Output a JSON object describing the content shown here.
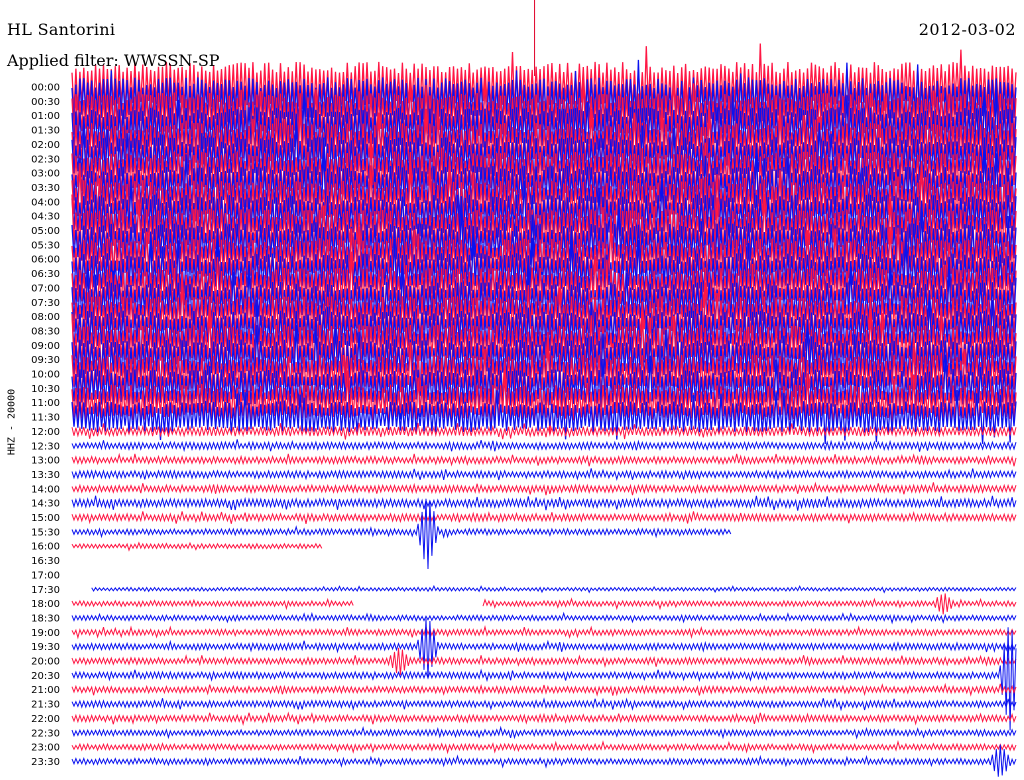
{
  "header": {
    "station": "HL Santorini",
    "date": "2012-03-02",
    "filter": "Applied filter: WWSSN-SP",
    "channel": "HHZ - 20000"
  },
  "colors": {
    "trace_a": "#ff1744",
    "trace_b": "#0a12f0",
    "marker": "#e0002a",
    "background": "#ffffff"
  },
  "chart_data": {
    "type": "line",
    "title": "HL Santorini",
    "subtitle": "Applied filter: WWSSN-SP",
    "date": "2012-03-02",
    "ylabel": "HHZ - 20000",
    "xlabel": "",
    "grid": false,
    "rows_per_hour": 2,
    "row_minutes": 30,
    "row_labels": [
      "00:00",
      "00:30",
      "01:00",
      "01:30",
      "02:00",
      "02:30",
      "03:00",
      "03:30",
      "04:00",
      "04:30",
      "05:00",
      "05:30",
      "06:00",
      "06:30",
      "07:00",
      "07:30",
      "08:00",
      "08:30",
      "09:00",
      "09:30",
      "10:00",
      "10:30",
      "11:00",
      "11:30",
      "12:00",
      "12:30",
      "13:00",
      "13:30",
      "14:00",
      "14:30",
      "15:00",
      "15:30",
      "16:00",
      "16:30",
      "17:00",
      "17:30",
      "18:00",
      "18:30",
      "19:00",
      "19:30",
      "20:00",
      "20:30",
      "21:00",
      "21:30",
      "22:00",
      "22:30",
      "23:00",
      "23:30"
    ],
    "trace_color_cycle": [
      "trace_a",
      "trace_b"
    ],
    "relative_amplitude": [
      4.2,
      4.0,
      3.8,
      3.8,
      3.6,
      3.6,
      3.6,
      3.6,
      3.6,
      3.6,
      3.6,
      3.6,
      3.4,
      3.4,
      3.4,
      3.4,
      3.4,
      3.4,
      3.4,
      3.4,
      3.2,
      3.2,
      3.0,
      2.6,
      0.8,
      0.6,
      0.6,
      0.6,
      0.6,
      0.7,
      0.6,
      0.5,
      0.4,
      0.2,
      0.05,
      0.3,
      0.45,
      0.45,
      0.5,
      0.55,
      0.55,
      0.55,
      0.55,
      0.55,
      0.55,
      0.5,
      0.5,
      0.5
    ],
    "data_gaps": [
      {
        "row": "15:30",
        "from_minute": 21,
        "to_minute": 30
      },
      {
        "row": "16:00",
        "from_minute": 8,
        "to_minute": 30
      },
      {
        "row": "16:30",
        "from_minute": 0,
        "to_minute": 30
      },
      {
        "row": "17:00",
        "from_minute": 0,
        "to_minute": 30
      },
      {
        "row": "17:30",
        "from_minute": 0,
        "to_minute": 0.6
      },
      {
        "row": "18:00",
        "from_minute": 9,
        "to_minute": 13
      }
    ],
    "events": [
      {
        "row": "15:30",
        "minute": 11.3,
        "amplitude": 6
      },
      {
        "row": "19:30",
        "minute": 11.3,
        "amplitude": 5
      },
      {
        "row": "20:00",
        "minute": 10.4,
        "amplitude": 2
      },
      {
        "row": "18:00",
        "minute": 27.7,
        "amplitude": 1.5
      },
      {
        "row": "23:30",
        "minute": 29.5,
        "amplitude": 2.5
      },
      {
        "row": "20:30",
        "minute": 29.8,
        "amplitude": 9
      }
    ],
    "time_marker_minute": 14.7
  }
}
